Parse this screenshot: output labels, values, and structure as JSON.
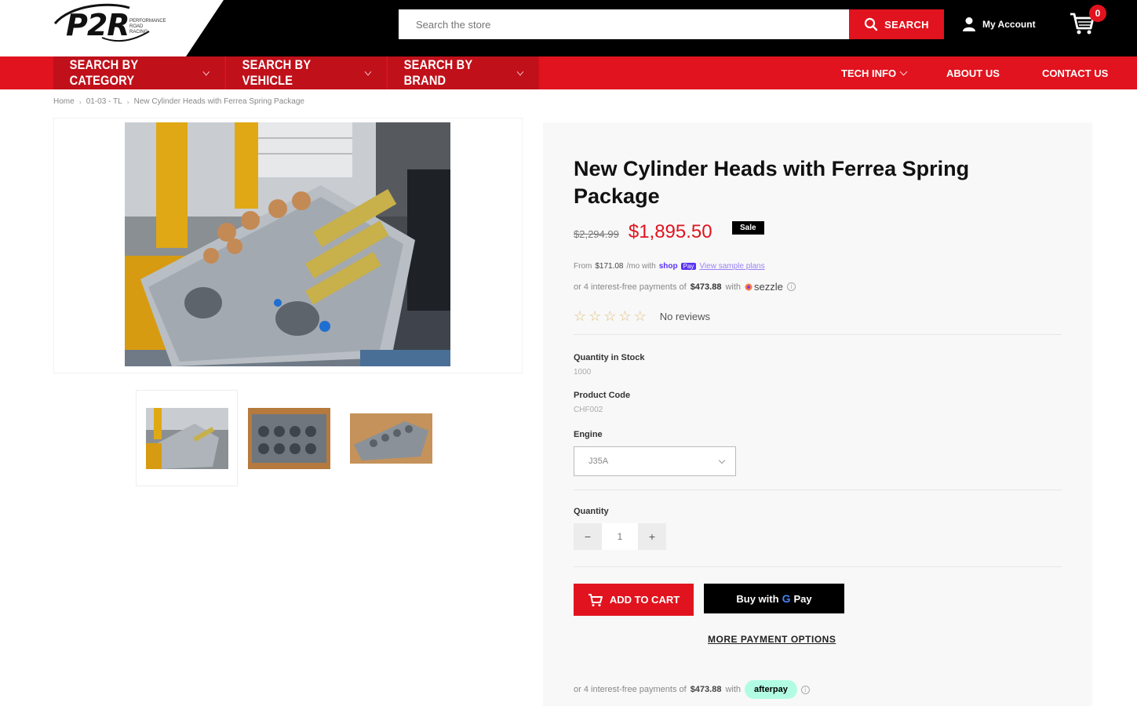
{
  "header": {
    "logo_text": "P2R",
    "logo_tagline": "PERFORMANCE ROAD RACING",
    "search_placeholder": "Search the store",
    "search_button": "SEARCH",
    "account_label": "My Account",
    "cart_count": "0"
  },
  "nav": {
    "left_items": [
      {
        "label": "SEARCH BY CATEGORY"
      },
      {
        "label": "SEARCH BY VEHICLE"
      },
      {
        "label": "SEARCH BY BRAND"
      }
    ],
    "right_items": [
      {
        "label": "TECH INFO"
      },
      {
        "label": "ABOUT US"
      },
      {
        "label": "CONTACT US"
      }
    ]
  },
  "breadcrumb": [
    "Home",
    "01-03 - TL",
    "New Cylinder Heads with Ferrea Spring Package"
  ],
  "product": {
    "title": "New Cylinder Heads with Ferrea Spring Package",
    "old_price": "$2,294.99",
    "price": "$1,895.50",
    "sale_badge": "Sale",
    "shop_pay": {
      "prefix": "From",
      "amount": "$171.08",
      "mid": "/mo with",
      "brand": "shop",
      "brand_badge": "Pay",
      "link": "View sample plans"
    },
    "sezzle": {
      "prefix": "or 4 interest-free payments of",
      "amount": "$473.88",
      "mid": "with",
      "brand": "sezzle"
    },
    "reviews_text": "No reviews",
    "stock_label": "Quantity in Stock",
    "stock_value": "1000",
    "code_label": "Product Code",
    "code_value": "CHF002",
    "engine_label": "Engine",
    "engine_selected": "J35A",
    "quantity_label": "Quantity",
    "quantity_value": "1",
    "add_to_cart": "ADD TO CART",
    "buy_with_prefix": "Buy with",
    "buy_with_brand": "Pay",
    "more_payment": "MORE PAYMENT OPTIONS",
    "afterpay": {
      "prefix": "or 4 interest-free payments of",
      "amount": "$473.88",
      "mid": "with",
      "brand": "afterpay"
    }
  },
  "colors": {
    "brand_red": "#e1131e",
    "dark_red": "#c0101a",
    "black": "#000000",
    "afterpay_mint": "#b2fce4",
    "shop_purple": "#5a31f4"
  }
}
